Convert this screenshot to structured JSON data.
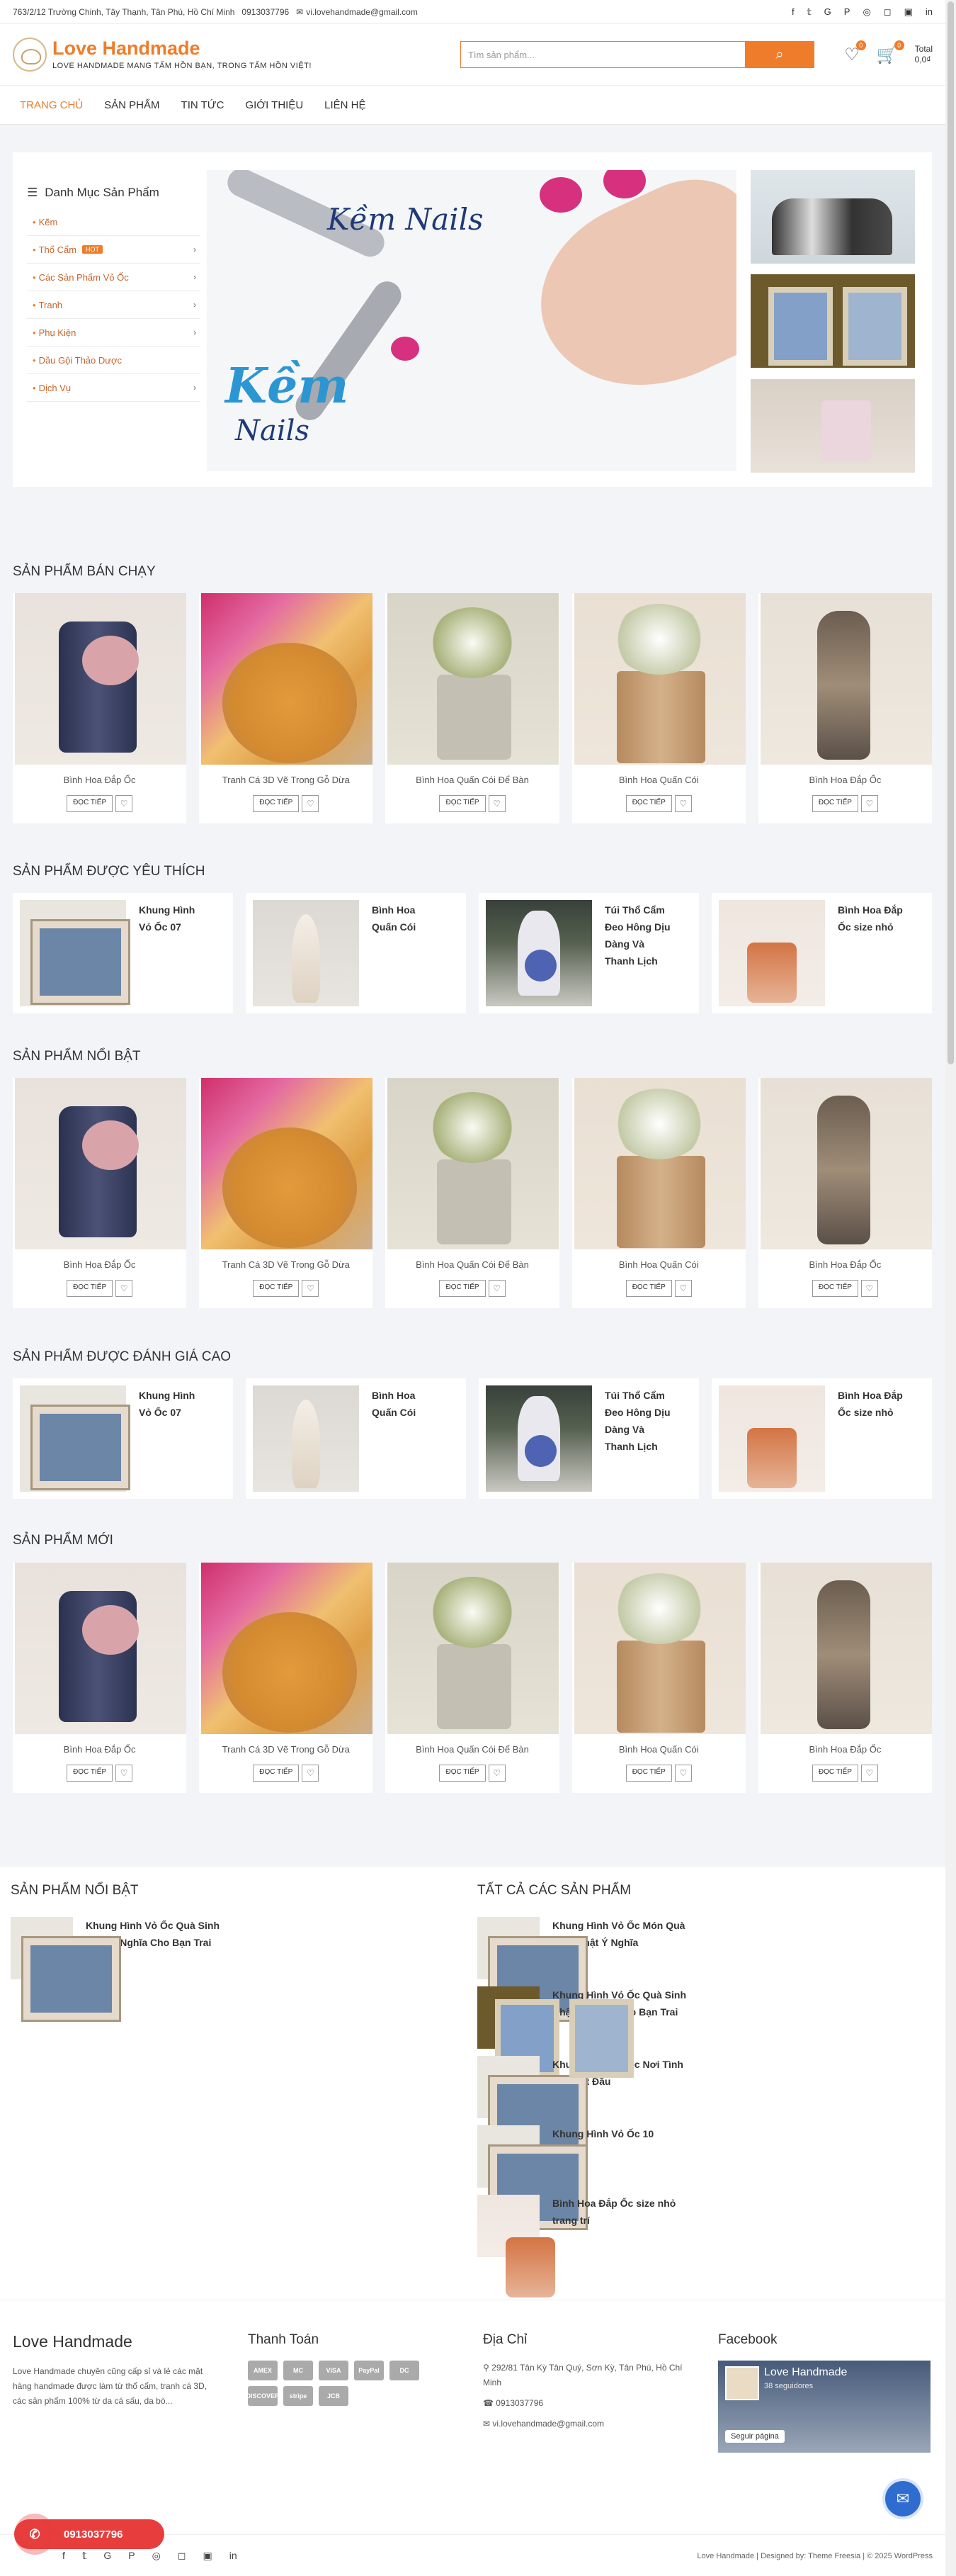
{
  "topbar": {
    "address": "763/2/12 Trường Chinh, Tây Thạnh, Tân Phú, Hồ Chí Minh",
    "phone": "0913037796",
    "email": "vi.lovehandmade@gmail.com"
  },
  "brand": {
    "name": "Love Handmade",
    "tagline": "LOVE HANDMADE MANG TẤM HỒN BẠN, TRONG TẤM HỒN VIỆT!",
    "accent": "#ef7c2a"
  },
  "search": {
    "placeholder": "Tìm sản phẩm..."
  },
  "header": {
    "wishlist_count": "0",
    "cart_count": "0",
    "cart_label": "Total",
    "cart_total": "0,0₫"
  },
  "nav": [
    "TRANG CHỦ",
    "SẢN PHẨM",
    "TIN TỨC",
    "GIỚI THIỆU",
    "LIÊN HỆ"
  ],
  "categories": {
    "title": "Danh Mục Sản Phẩm",
    "items": [
      {
        "label": "Kẽm",
        "hot": "",
        "arrow": false
      },
      {
        "label": "Thổ Cẩm",
        "hot": "HOT",
        "arrow": true
      },
      {
        "label": "Các Sản Phẩm Vỏ Ốc",
        "hot": "",
        "arrow": true
      },
      {
        "label": "Tranh",
        "hot": "",
        "arrow": true
      },
      {
        "label": "Phụ Kiện",
        "hot": "",
        "arrow": true
      },
      {
        "label": "Dầu Gội Thảo Dược",
        "hot": "",
        "arrow": false
      },
      {
        "label": "Dịch Vụ",
        "hot": "",
        "arrow": true
      }
    ]
  },
  "banner": {
    "logo_text": "Kềm Nails",
    "big_text": "Kềm",
    "sub_text": "Nails"
  },
  "buttons": {
    "read_more": "ĐỌC TIẾP"
  },
  "sections": {
    "best_selling": "SẢN PHẨM BÁN CHẠY",
    "favorite": "SẢN PHẨM ĐƯỢC YÊU THÍCH",
    "featured": "SẢN PHẨM NỔI BẬT",
    "top_rated": "SẢN PHẨM ĐƯỢC ĐÁNH GIÁ CAO",
    "new": "SẢN PHẨM MỚI"
  },
  "products": [
    "Bình Hoa Đắp Ốc",
    "Tranh Cá 3D Vẽ Trong Gỗ Dừa",
    "Bình Hoa Quấn Cói Để Bàn",
    "Bình Hoa Quấn Cói",
    "Bình Hoa Đắp Ốc"
  ],
  "mini_products": [
    "Khung Hình Vỏ Ốc 07",
    "Bình Hoa Quấn Cói",
    "Túi Thổ Cẩm Đeo Hông Dịu Dàng Và Thanh Lịch",
    "Bình Hoa Đắp Ốc size nhỏ"
  ],
  "widgets": {
    "featured_title": "SẢN PHẨM NỔI BẬT",
    "featured_items": [
      "Khung Hình Vỏ Ốc Quà Sinh Nhật Ý Nghĩa Cho Bạn Trai"
    ],
    "all_title": "TẤT CẢ CÁC SẢN PHẨM",
    "all_items": [
      "Khung Hình Vỏ Ốc Món Quà Sinh Nhật Ý Nghĩa",
      "Khung Hình Vỏ Ốc Quà Sinh Nhật Ý Nghĩa Cho Bạn Trai",
      "Khung Hình Vỏ Ốc Nơi Tình Yêu Bắt Đầu",
      "Khung Hình Vỏ Ốc 10",
      "Bình Hoa Đắp Ốc size nhỏ trang trí"
    ]
  },
  "footer": {
    "about_title": "Love Handmade",
    "about_text": "Love Handmade chuyên cũng cấp sỉ và lẻ các mặt hàng handmade được làm từ thổ cẩm, tranh cá 3D, các sản phẩm 100% từ da cá sấu, da bò...",
    "pay_title": "Thanh Toán",
    "pay_methods": [
      "AMEX",
      "MC",
      "VISA",
      "PayPal",
      "DC",
      "DISCOVER",
      "stripe",
      "JCB"
    ],
    "addr_title": "Địa Chỉ",
    "address": "292/81 Tân Kỳ Tân Quý, Sơn Kỳ, Tân Phú, Hồ Chí Minh",
    "phone": "0913037796",
    "email": "vi.lovehandmade@gmail.com",
    "fb_title": "Facebook",
    "fb_page": "Love Handmade",
    "fb_followers": "38 seguidores",
    "fb_follow": "Seguir página",
    "copyright": "Love Handmade | Designed by: Theme Freesia | © 2025 WordPress"
  },
  "call": {
    "phone": "0913037796"
  }
}
